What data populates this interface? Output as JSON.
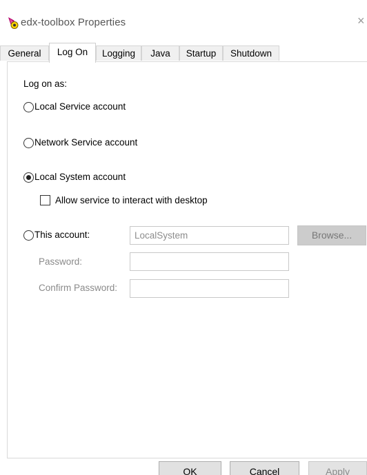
{
  "window": {
    "title": "edx-toolbox Properties",
    "close_glyph": "×",
    "icon": "app-icon"
  },
  "tabs": [
    {
      "label": "General",
      "active": false
    },
    {
      "label": "Log On",
      "active": true
    },
    {
      "label": "Logging",
      "active": false
    },
    {
      "label": "Java",
      "active": false
    },
    {
      "label": "Startup",
      "active": false
    },
    {
      "label": "Shutdown",
      "active": false
    }
  ],
  "logon": {
    "heading": "Log on as:",
    "options": {
      "local_service": {
        "label": "Local Service account",
        "selected": false
      },
      "network_service": {
        "label": "Network Service account",
        "selected": false
      },
      "local_system": {
        "label": "Local System account",
        "selected": true
      },
      "this_account": {
        "label": "This account:",
        "selected": false
      }
    },
    "interact_desktop": {
      "label": "Allow service to interact with desktop",
      "checked": false
    },
    "account_value": "LocalSystem",
    "browse_label": "Browse...",
    "password_label": "Password:",
    "password_value": "",
    "confirm_label": "Confirm Password:",
    "confirm_value": ""
  },
  "buttons": {
    "ok": "OK",
    "cancel": "Cancel",
    "apply": "Apply"
  },
  "colors": {
    "panel_border": "#d9d9d9",
    "disabled_text": "#8a8a8a",
    "browse_bg": "#cccccc"
  }
}
